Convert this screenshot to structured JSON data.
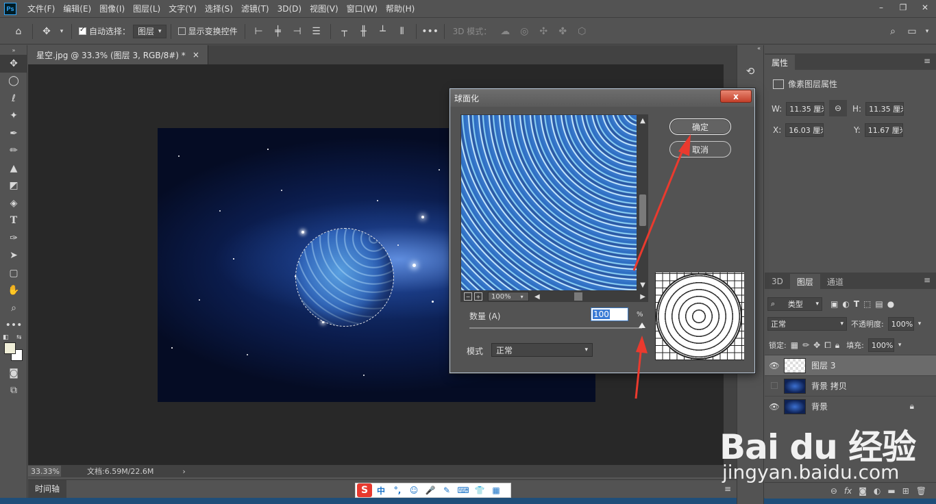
{
  "app": {
    "logo": "Ps"
  },
  "menubar": {
    "items": [
      "文件(F)",
      "编辑(E)",
      "图像(I)",
      "图层(L)",
      "文字(Y)",
      "选择(S)",
      "滤镜(T)",
      "3D(D)",
      "视图(V)",
      "窗口(W)",
      "帮助(H)"
    ]
  },
  "options": {
    "auto_select_label": "自动选择：",
    "auto_select_target": "图层",
    "show_transform_label": "显示变换控件",
    "mode3d_label": "3D 模式："
  },
  "document": {
    "tab_title": "星空.jpg @ 33.3% (图层 3, RGB/8#) *",
    "close_glyph": "×"
  },
  "statusbar": {
    "zoom": "33.33%",
    "doc_info": "文档:6.59M/22.6M",
    "arrow": "›"
  },
  "timeline": {
    "label": "时间轴"
  },
  "ime": {
    "logo": "S",
    "items": [
      "中",
      "°,",
      "☺",
      "🎤",
      "✎",
      "⌨",
      "👕",
      "▦"
    ]
  },
  "properties": {
    "tab": "属性",
    "header": "像素图层属性",
    "w_label": "W:",
    "w_value": "11.35 厘米",
    "h_label": "H:",
    "h_value": "11.35 厘米",
    "x_label": "X:",
    "x_value": "16.03 厘米",
    "y_label": "Y:",
    "y_value": "11.67 厘米"
  },
  "layers_panel": {
    "tabs": [
      "3D",
      "图层",
      "通道"
    ],
    "filter_kind": "类型",
    "blend_mode": "正常",
    "opacity_label": "不透明度:",
    "opacity_value": "100%",
    "lock_label": "锁定:",
    "fill_label": "填充:",
    "fill_value": "100%",
    "layers": [
      {
        "name": "图层 3",
        "visible": true,
        "selected": true
      },
      {
        "name": "背景 拷贝",
        "visible": false,
        "selected": false
      },
      {
        "name": "背景",
        "visible": true,
        "selected": false,
        "locked": true
      }
    ],
    "footer_fx": "fx"
  },
  "dialog": {
    "title": "球面化",
    "close_glyph": "x",
    "ok_label": "确定",
    "cancel_label": "取消",
    "zoom": "100%",
    "amount_label": "数量 (A)",
    "amount_value": "100",
    "amount_unit": "%",
    "amount_fraction": 1.0,
    "mode_label": "模式",
    "mode_value": "正常"
  },
  "watermark": {
    "main": "Bai du 经验",
    "sub": "jingyan.baidu.com"
  }
}
